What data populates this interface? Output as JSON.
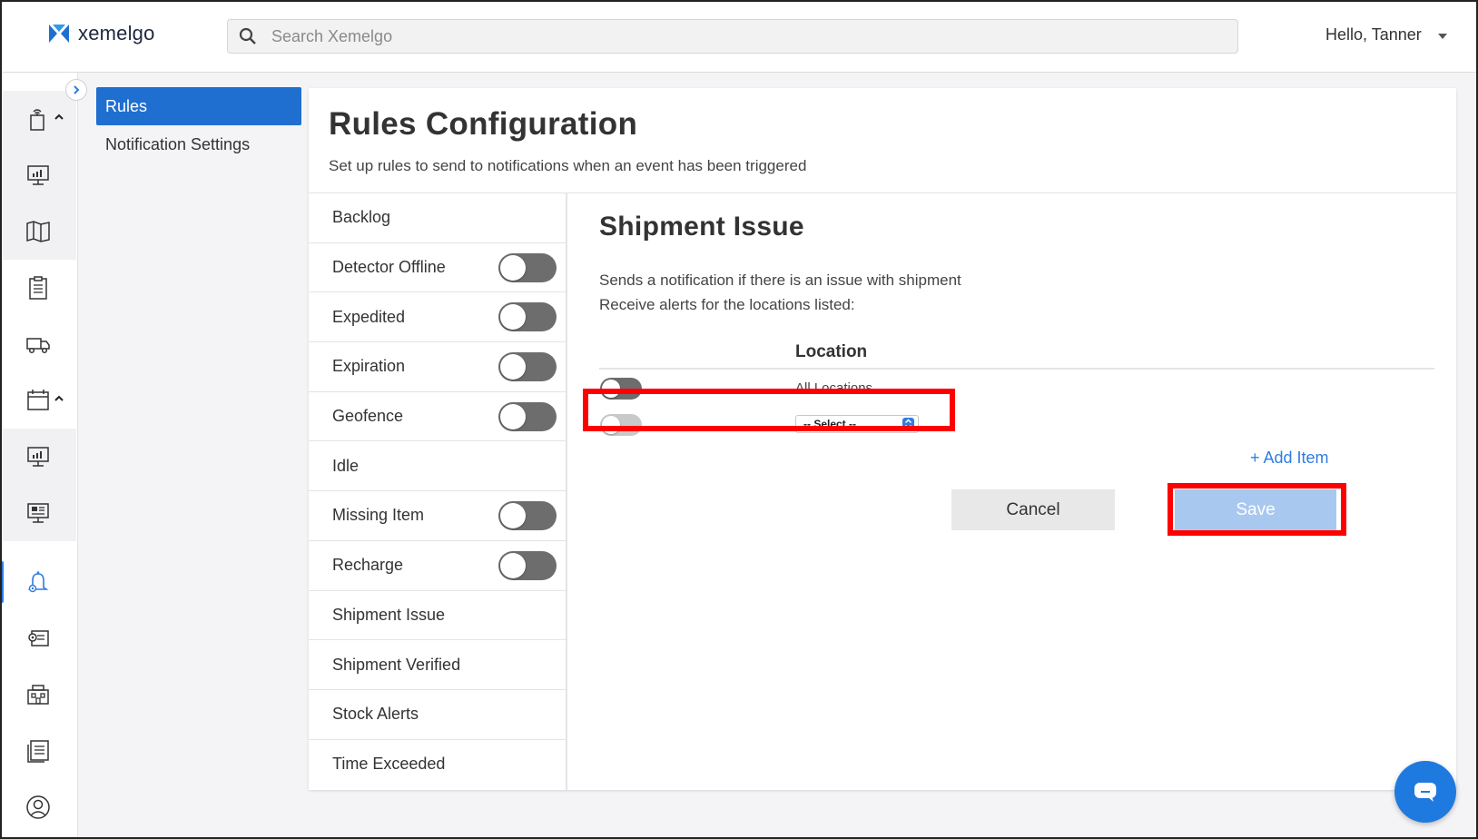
{
  "brand": {
    "name": "xemelgo",
    "accent": "#1f6fd1"
  },
  "search": {
    "placeholder": "Search Xemelgo"
  },
  "user": {
    "greeting": "Hello, Tanner"
  },
  "rail": {
    "icons": [
      "tracking-icon",
      "dashboard-icon",
      "map-icon",
      "clipboard-icon",
      "truck-icon",
      "calendar-icon",
      "monitor-chart-icon",
      "monitor-icon",
      "alert-bell-icon",
      "inventory-settings-icon",
      "building-icon",
      "report-list-icon",
      "user-profile-icon"
    ],
    "active": "alert-bell-icon"
  },
  "subnav": {
    "items": [
      "Rules",
      "Notification Settings"
    ],
    "active": "Rules"
  },
  "page": {
    "title": "Rules Configuration",
    "subtitle": "Set up rules to send to notifications when an event has been triggered"
  },
  "rules": [
    {
      "label": "Backlog",
      "toggle": null
    },
    {
      "label": "Detector Offline",
      "toggle": false
    },
    {
      "label": "Expedited",
      "toggle": false
    },
    {
      "label": "Expiration",
      "toggle": false
    },
    {
      "label": "Geofence",
      "toggle": false
    },
    {
      "label": "Idle",
      "toggle": null
    },
    {
      "label": "Missing Item",
      "toggle": false
    },
    {
      "label": "Recharge",
      "toggle": false
    },
    {
      "label": "Shipment Issue",
      "toggle": null
    },
    {
      "label": "Shipment Verified",
      "toggle": null
    },
    {
      "label": "Stock Alerts",
      "toggle": null
    },
    {
      "label": "Time Exceeded",
      "toggle": null
    }
  ],
  "detail": {
    "title": "Shipment Issue",
    "description": "Sends a notification if there is an issue with shipment",
    "alerts_label": "Receive alerts for the locations listed:",
    "location_header": "Location",
    "all_locations": "All Locations",
    "select_placeholder": "-- Select --",
    "add_item": "+ Add Item",
    "cancel": "Cancel",
    "save": "Save"
  },
  "colors": {
    "highlight": "#ff0000",
    "save_disabled": "#a9c8f0",
    "link": "#2f7de0"
  }
}
